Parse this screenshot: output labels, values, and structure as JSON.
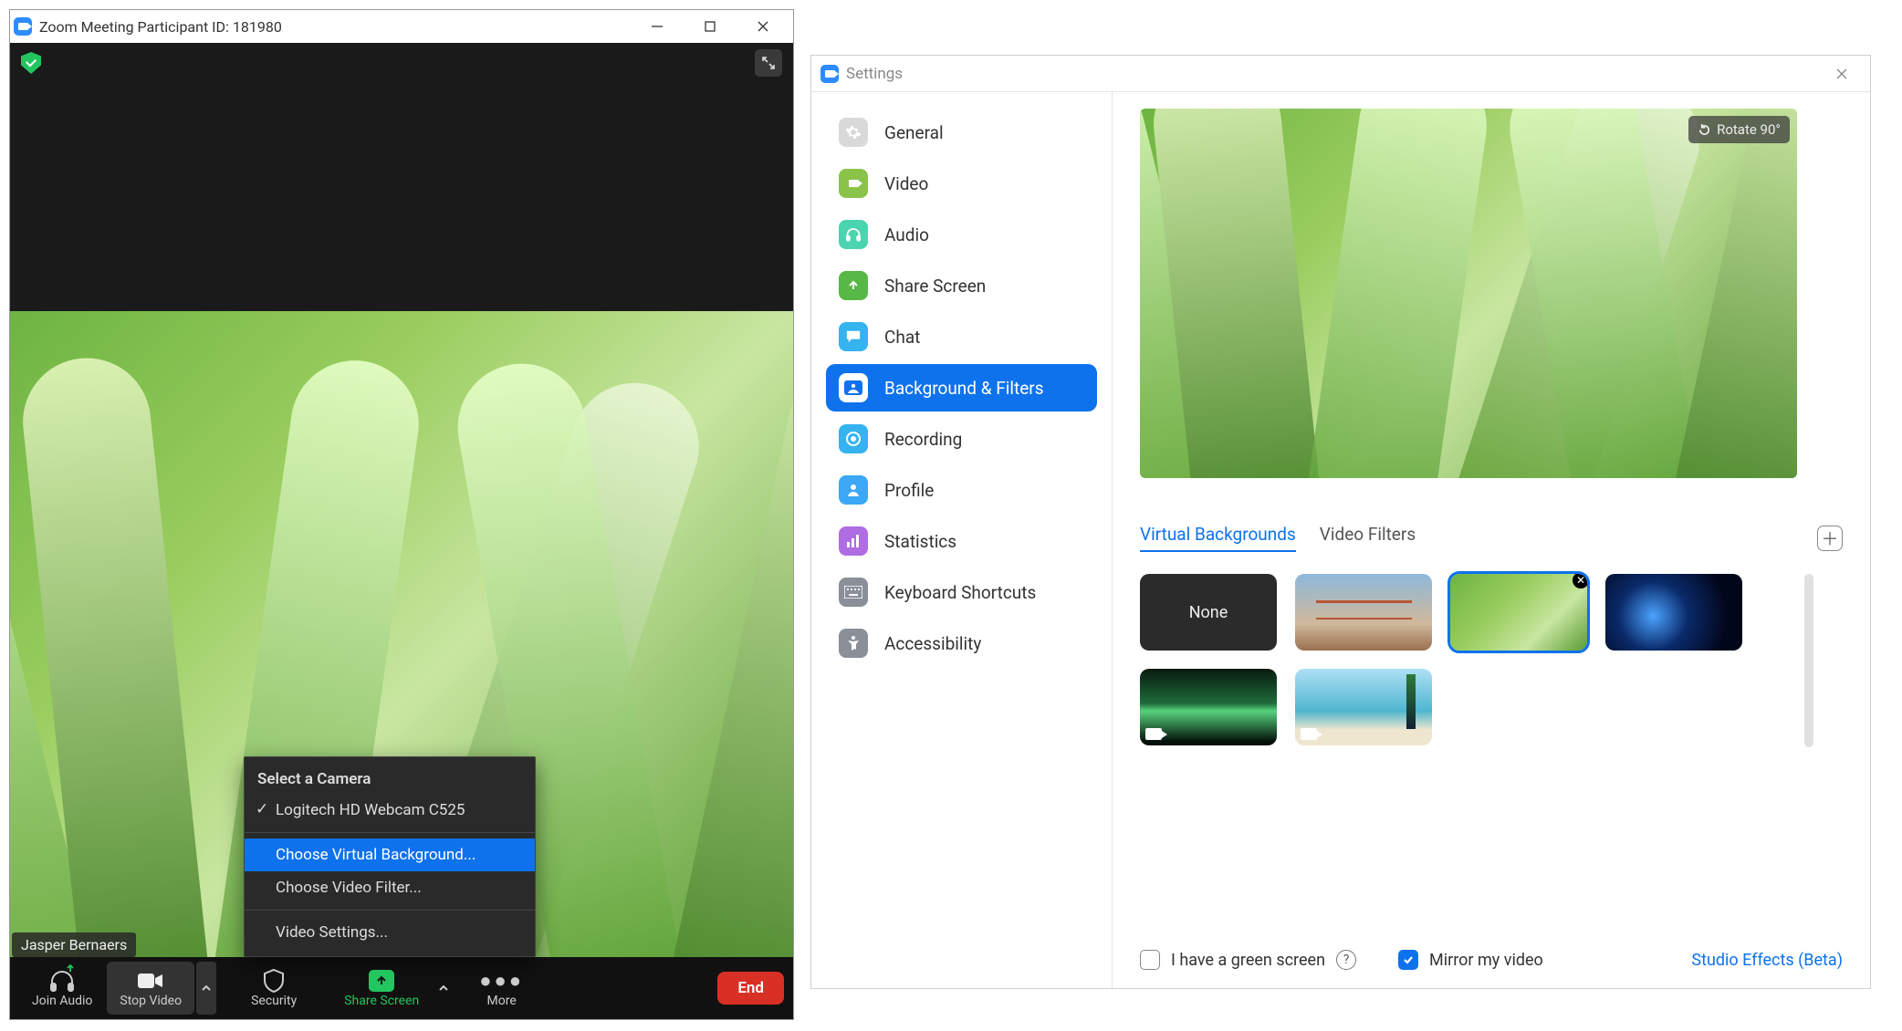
{
  "meeting": {
    "title": "Zoom Meeting Participant ID: 181980",
    "name_tag": "Jasper Bernaers",
    "camera_menu": {
      "header": "Select a Camera",
      "camera": "Logitech HD Webcam C525",
      "choose_bg": "Choose Virtual Background...",
      "choose_filter": "Choose Video Filter...",
      "video_settings": "Video Settings..."
    },
    "toolbar": {
      "join_audio": "Join Audio",
      "stop_video": "Stop Video",
      "security": "Security",
      "share_screen": "Share Screen",
      "more": "More",
      "end": "End"
    }
  },
  "settings": {
    "title": "Settings",
    "rotate": "Rotate 90°",
    "nav": {
      "general": "General",
      "video": "Video",
      "audio": "Audio",
      "share": "Share Screen",
      "chat": "Chat",
      "bg": "Background & Filters",
      "recording": "Recording",
      "profile": "Profile",
      "stats": "Statistics",
      "keyboard": "Keyboard Shortcuts",
      "accessibility": "Accessibility"
    },
    "tabs": {
      "vb": "Virtual Backgrounds",
      "vf": "Video Filters"
    },
    "thumbs": {
      "none": "None"
    },
    "bottom": {
      "greenscreen": "I have a green screen",
      "mirror": "Mirror my video",
      "studio": "Studio Effects (Beta)"
    }
  }
}
